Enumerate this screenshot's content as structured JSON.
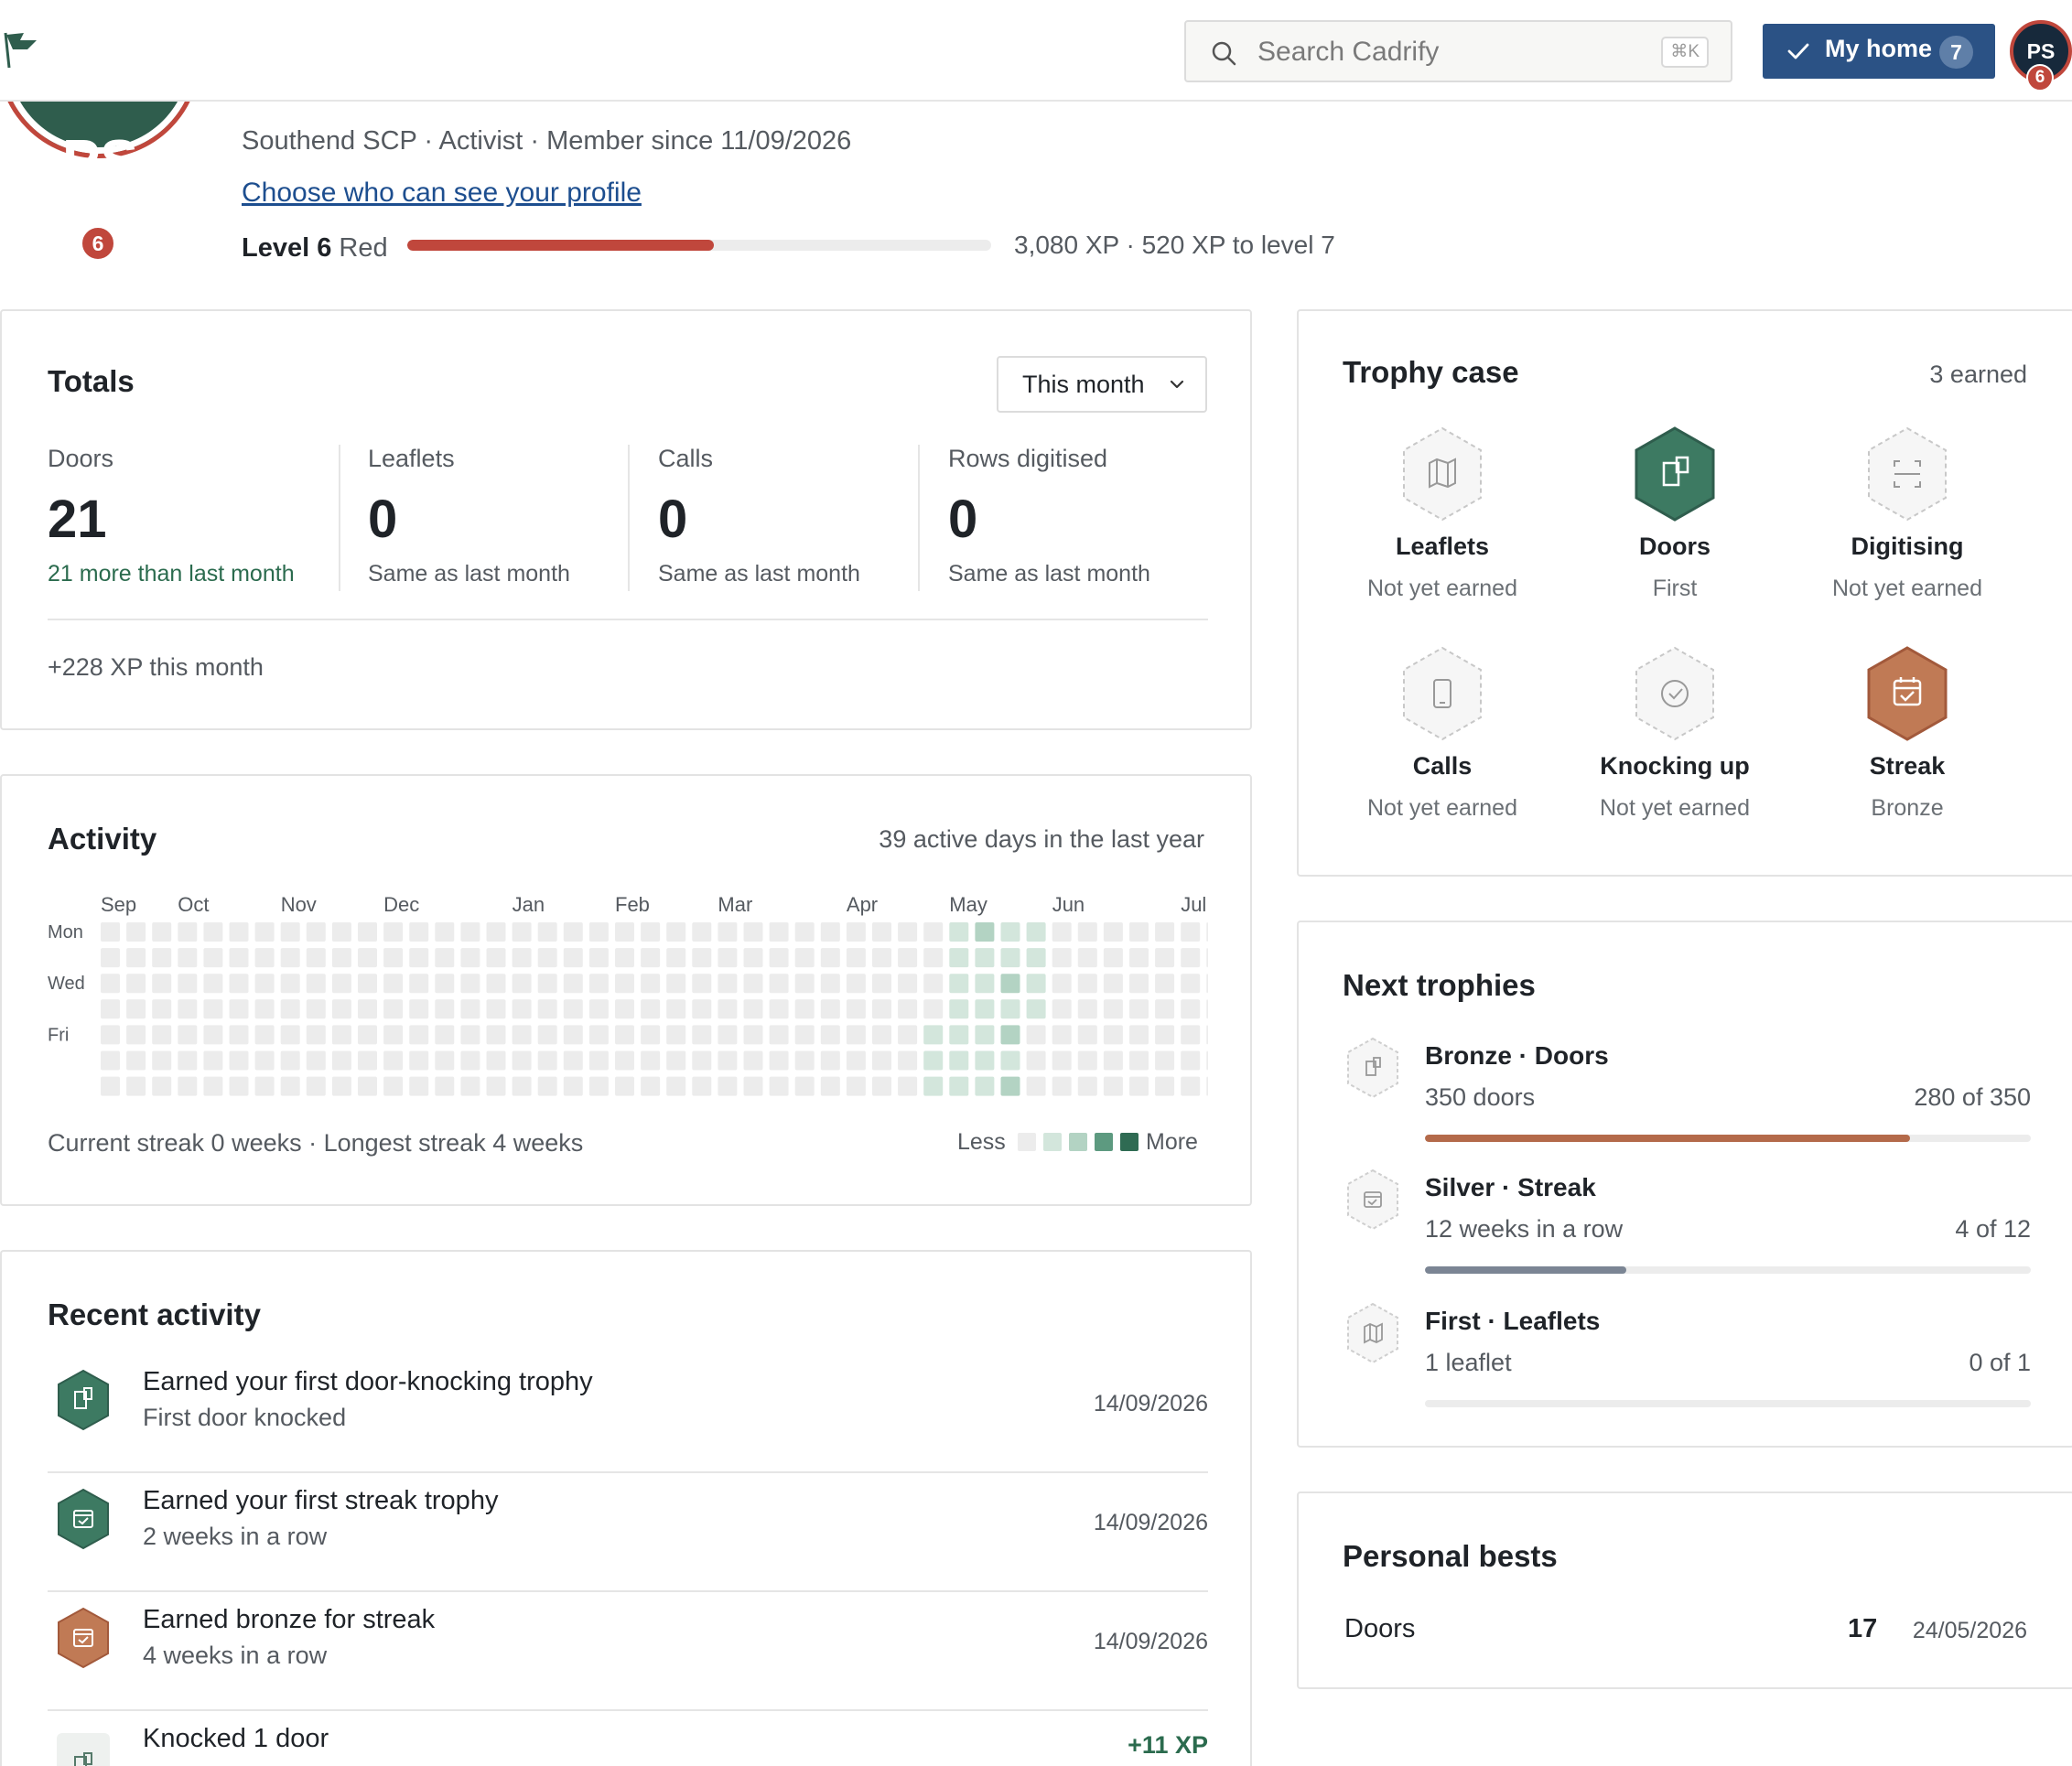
{
  "topbar": {
    "search_placeholder": "Search Cadrify",
    "search_shortcut": "⌘K",
    "home_label": "My home",
    "home_count": "7",
    "avatar_initials": "PS",
    "avatar_badge": "6"
  },
  "profile": {
    "initials": "PS",
    "level_badge": "6",
    "meta": "Southend SCP · Activist · Member since 11/09/2026",
    "visibility_link": "Choose who can see your profile",
    "level_label": "Level 6",
    "level_color": "Red",
    "xp_fraction": 0.525,
    "xp_text": "3,080 XP · 520 XP to level 7"
  },
  "totals": {
    "title": "Totals",
    "period": "This month",
    "stats": [
      {
        "label": "Doors",
        "value": "21",
        "compare": "21 more than last month",
        "trend": "up"
      },
      {
        "label": "Leaflets",
        "value": "0",
        "compare": "Same as last month",
        "trend": "same"
      },
      {
        "label": "Calls",
        "value": "0",
        "compare": "Same as last month",
        "trend": "same"
      },
      {
        "label": "Rows digitised",
        "value": "0",
        "compare": "Same as last month",
        "trend": "same"
      }
    ],
    "xp_month": "+228 XP this month"
  },
  "activity": {
    "title": "Activity",
    "summary": "39 active days in the last year",
    "months": [
      {
        "label": "Sep",
        "week": 0
      },
      {
        "label": "Oct",
        "week": 3
      },
      {
        "label": "Nov",
        "week": 7
      },
      {
        "label": "Dec",
        "week": 11
      },
      {
        "label": "Jan",
        "week": 16
      },
      {
        "label": "Feb",
        "week": 20
      },
      {
        "label": "Mar",
        "week": 24
      },
      {
        "label": "Apr",
        "week": 29
      },
      {
        "label": "May",
        "week": 33
      },
      {
        "label": "Jun",
        "week": 37
      },
      {
        "label": "Jul",
        "week": 42
      }
    ],
    "day_labels": [
      {
        "label": "Mon",
        "row": 0
      },
      {
        "label": "Wed",
        "row": 2
      },
      {
        "label": "Fri",
        "row": 4
      }
    ],
    "weeks": 44,
    "active_cells": [
      {
        "week": 33,
        "day": 0,
        "level": 1
      },
      {
        "week": 34,
        "day": 0,
        "level": 2
      },
      {
        "week": 35,
        "day": 0,
        "level": 1
      },
      {
        "week": 36,
        "day": 0,
        "level": 1
      },
      {
        "week": 33,
        "day": 1,
        "level": 1
      },
      {
        "week": 34,
        "day": 1,
        "level": 1
      },
      {
        "week": 35,
        "day": 1,
        "level": 1
      },
      {
        "week": 36,
        "day": 1,
        "level": 1
      },
      {
        "week": 33,
        "day": 2,
        "level": 1
      },
      {
        "week": 34,
        "day": 2,
        "level": 1
      },
      {
        "week": 35,
        "day": 2,
        "level": 2
      },
      {
        "week": 36,
        "day": 2,
        "level": 1
      },
      {
        "week": 33,
        "day": 3,
        "level": 1
      },
      {
        "week": 34,
        "day": 3,
        "level": 1
      },
      {
        "week": 35,
        "day": 3,
        "level": 1
      },
      {
        "week": 36,
        "day": 3,
        "level": 1
      },
      {
        "week": 32,
        "day": 4,
        "level": 1
      },
      {
        "week": 33,
        "day": 4,
        "level": 1
      },
      {
        "week": 34,
        "day": 4,
        "level": 1
      },
      {
        "week": 35,
        "day": 4,
        "level": 2
      },
      {
        "week": 32,
        "day": 5,
        "level": 1
      },
      {
        "week": 33,
        "day": 5,
        "level": 1
      },
      {
        "week": 34,
        "day": 5,
        "level": 1
      },
      {
        "week": 35,
        "day": 5,
        "level": 1
      },
      {
        "week": 32,
        "day": 6,
        "level": 1
      },
      {
        "week": 33,
        "day": 6,
        "level": 1
      },
      {
        "week": 34,
        "day": 6,
        "level": 1
      },
      {
        "week": 35,
        "day": 6,
        "level": 2
      }
    ],
    "level_colors": [
      "#ececec",
      "#d3e6dc",
      "#b3d3c3",
      "#5d9a80",
      "#2f6b53"
    ],
    "streak_text": "Current streak 0 weeks · Longest streak 4 weeks",
    "legend_less": "Less",
    "legend_more": "More"
  },
  "recent": {
    "title": "Recent activity",
    "items": [
      {
        "title": "Earned your first door-knocking trophy",
        "subtitle": "First door knocked",
        "date": "14/09/2026",
        "icon": "door-icon",
        "tone": "green"
      },
      {
        "title": "Earned your first streak trophy",
        "subtitle": "2 weeks in a row",
        "date": "14/09/2026",
        "icon": "calendar-check-icon",
        "tone": "green"
      },
      {
        "title": "Earned bronze for streak",
        "subtitle": "4 weeks in a row",
        "date": "14/09/2026",
        "icon": "calendar-check-icon",
        "tone": "bronze"
      },
      {
        "title": "Knocked 1 door",
        "subtitle": "",
        "xp": "+11 XP",
        "icon": "door-icon",
        "tone": "grey"
      }
    ]
  },
  "trophy_case": {
    "title": "Trophy case",
    "earned": "3 earned",
    "items": [
      {
        "name": "Leaflets",
        "status": "Not yet earned",
        "icon": "map-icon",
        "tone": "outline"
      },
      {
        "name": "Doors",
        "status": "First",
        "icon": "door-icon",
        "tone": "green"
      },
      {
        "name": "Digitising",
        "status": "Not yet earned",
        "icon": "scan-icon",
        "tone": "outline"
      },
      {
        "name": "Calls",
        "status": "Not yet earned",
        "icon": "phone-icon",
        "tone": "outline"
      },
      {
        "name": "Knocking up",
        "status": "Not yet earned",
        "icon": "check-circle-icon",
        "tone": "outline"
      },
      {
        "name": "Streak",
        "status": "Bronze",
        "icon": "calendar-check-icon",
        "tone": "bronze"
      }
    ]
  },
  "next_trophies": {
    "title": "Next trophies",
    "items": [
      {
        "title": "Bronze · Doors",
        "desc": "350 doors",
        "progress_text": "280 of 350",
        "fraction": 0.8,
        "bar_color": "#b46a4a",
        "icon": "door-icon"
      },
      {
        "title": "Silver · Streak",
        "desc": "12 weeks in a row",
        "progress_text": "4 of 12",
        "fraction": 0.333,
        "bar_color": "#7b8594",
        "icon": "calendar-check-icon"
      },
      {
        "title": "First · Leaflets",
        "desc": "1 leaflet",
        "progress_text": "0 of 1",
        "fraction": 0,
        "bar_color": "#b46a4a",
        "icon": "map-icon"
      }
    ]
  },
  "personal_bests": {
    "title": "Personal bests",
    "items": [
      {
        "label": "Doors",
        "value": "17",
        "date": "24/05/2026"
      }
    ]
  },
  "colors": {
    "brand_green": "#2f5d4d",
    "accent_red": "#c0473c",
    "nav_blue": "#2b5285",
    "bronze": "#b46a4a"
  }
}
